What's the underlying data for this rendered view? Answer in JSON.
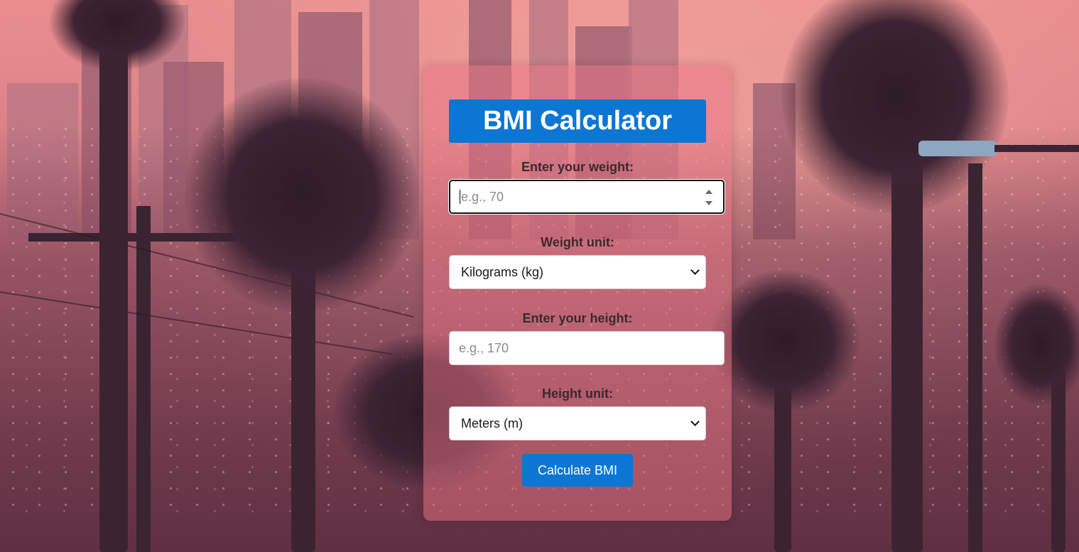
{
  "app": {
    "title": "BMI Calculator"
  },
  "form": {
    "weight_label": "Enter your weight:",
    "weight_placeholder": "e.g., 70",
    "weight_value": "",
    "weight_unit_label": "Weight unit:",
    "weight_unit_selected": "Kilograms (kg)",
    "height_label": "Enter your height:",
    "height_placeholder": "e.g., 170",
    "height_value": "",
    "height_unit_label": "Height unit:",
    "height_unit_selected": "Meters (m)",
    "submit_label": "Calculate BMI"
  },
  "colors": {
    "accent": "#0c76d2",
    "card_tint": "#e87484",
    "label_text": "#3a2a2e"
  },
  "icons": {
    "select_arrow": "chevron-down-icon",
    "number_spinner": "spinner-arrows-icon"
  }
}
